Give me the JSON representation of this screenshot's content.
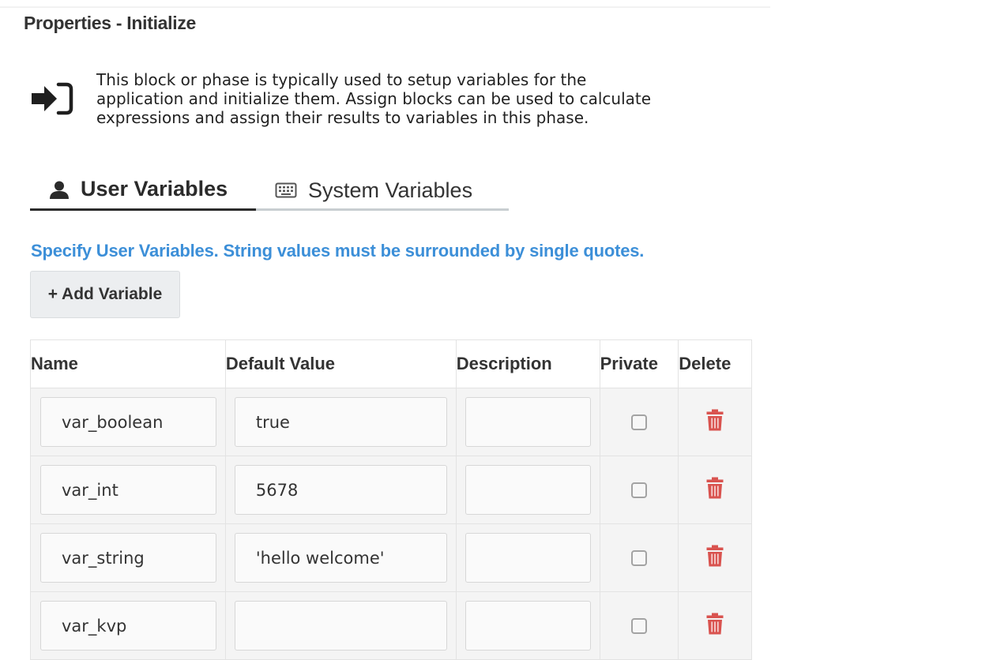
{
  "panel": {
    "title": "Properties - Initialize",
    "icon": "sign-in-icon",
    "description": "This block or phase is typically used to setup variables for the application and initialize them. Assign blocks can be used to calculate expressions and assign their results to variables in this phase."
  },
  "tabs": [
    {
      "label": "User Variables",
      "icon": "user-icon",
      "active": true
    },
    {
      "label": "System Variables",
      "icon": "keyboard-icon",
      "active": false
    }
  ],
  "hint": "Specify User Variables. String values must be surrounded by single quotes.",
  "add_button": "+ Add Variable",
  "table": {
    "headers": {
      "name": "Name",
      "default": "Default Value",
      "description": "Description",
      "private": "Private",
      "delete": "Delete"
    },
    "rows": [
      {
        "name": "var_boolean",
        "default": "true",
        "description": "",
        "private": false
      },
      {
        "name": "var_int",
        "default": "5678",
        "description": "",
        "private": false
      },
      {
        "name": "var_string",
        "default": "'hello welcome'",
        "description": "",
        "private": false
      },
      {
        "name": "var_kvp",
        "default": "",
        "description": "",
        "private": false
      }
    ]
  },
  "colors": {
    "hint": "#3c8fd8",
    "delete_icon": "#d9534f",
    "tab_active_underline": "#2b2b2b"
  }
}
